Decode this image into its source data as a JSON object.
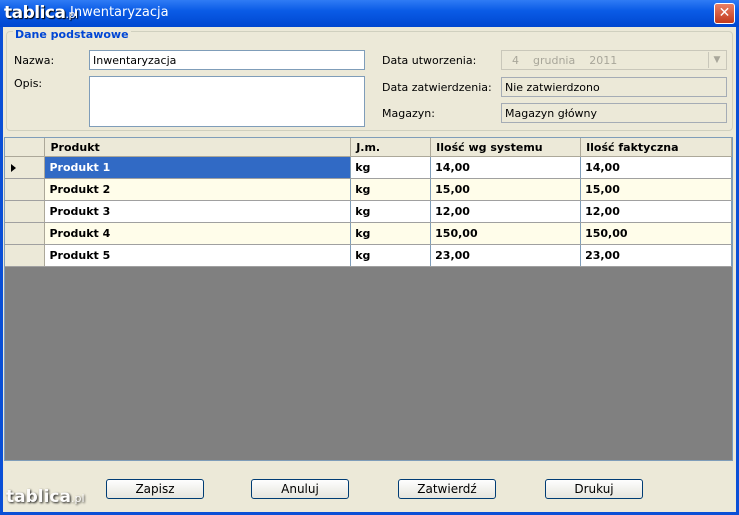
{
  "window": {
    "title": "Inwentaryzacja",
    "watermark_text": "tablica.pl"
  },
  "group": {
    "title": "Dane podstawowe"
  },
  "form": {
    "nazwa_label": "Nazwa:",
    "nazwa_value": "Inwentaryzacja",
    "opis_label": "Opis:",
    "opis_value": "",
    "data_utworzenia_label": "Data utworzenia:",
    "data_utworzenia_value": "4    grudnia    2011",
    "data_zatwierdzenia_label": "Data zatwierdzenia:",
    "data_zatwierdzenia_value": "Nie zatwierdzono",
    "magazyn_label": "Magazyn:",
    "magazyn_value": "Magazyn główny"
  },
  "table": {
    "columns": [
      "Produkt",
      "J.m.",
      "Ilość wg systemu",
      "Ilość faktyczna"
    ],
    "rows": [
      [
        "Produkt 1",
        "kg",
        "14,00",
        "14,00"
      ],
      [
        "Produkt 2",
        "kg",
        "15,00",
        "15,00"
      ],
      [
        "Produkt 3",
        "kg",
        "12,00",
        "12,00"
      ],
      [
        "Produkt 4",
        "kg",
        "150,00",
        "150,00"
      ],
      [
        "Produkt 5",
        "kg",
        "23,00",
        "23,00"
      ]
    ]
  },
  "buttons": {
    "save": "Zapisz",
    "cancel": "Anuluj",
    "approve": "Zatwierdź",
    "print": "Drukuj"
  },
  "colors": {
    "titlebar": "#0a5be6",
    "selection": "#316ac5",
    "alt_row": "#fffdea",
    "grid_bg": "#808080"
  }
}
